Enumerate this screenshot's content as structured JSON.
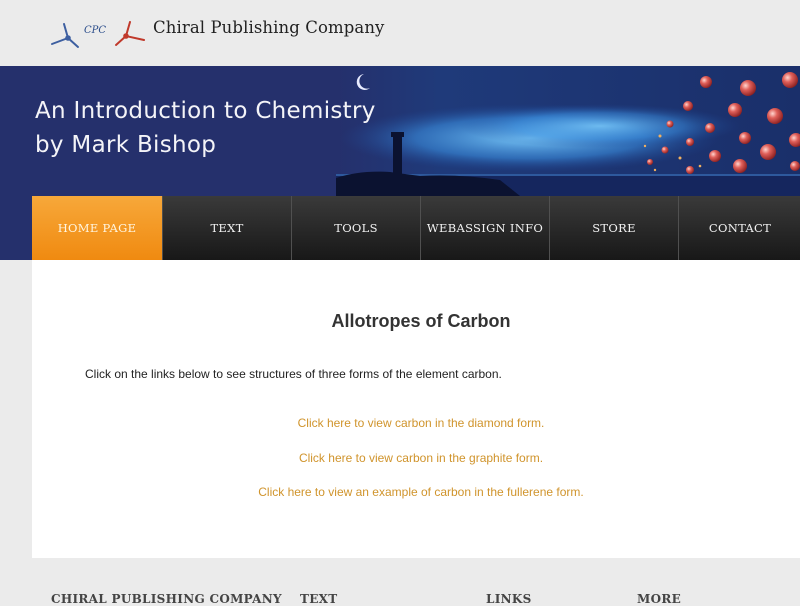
{
  "logo": {
    "abbr": "CPC"
  },
  "company_name": "Chiral Publishing Company",
  "banner": {
    "title_line1": "An Introduction to Chemistry",
    "title_line2": "by Mark Bishop"
  },
  "nav": {
    "items": [
      {
        "label": "HOME PAGE",
        "active": true
      },
      {
        "label": "TEXT"
      },
      {
        "label": "TOOLS"
      },
      {
        "label": "WEBASSIGN INFO"
      },
      {
        "label": "STORE"
      },
      {
        "label": "CONTACT"
      }
    ]
  },
  "main": {
    "title": "Allotropes of Carbon",
    "intro": "Click on the links below to see structures of three forms of the element carbon.",
    "links": [
      "Click here to view carbon in the diamond form.",
      "Click here to view carbon in the graphite form.",
      "Click here to view an example of carbon in the fullerene form."
    ]
  },
  "footer": {
    "headings": [
      "CHIRAL PUBLISHING COMPANY",
      "TEXT",
      "LINKS",
      "MORE"
    ]
  },
  "colors": {
    "banner_bg": "#25306c",
    "nav_active": "#f39a22",
    "link": "#d0942c"
  }
}
